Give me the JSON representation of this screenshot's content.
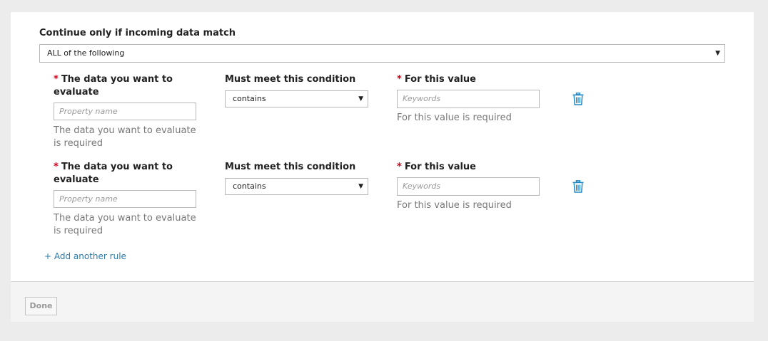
{
  "filter": {
    "match_label": "Continue only if incoming data match",
    "match_value": "ALL of the following"
  },
  "rules": [
    {
      "required_mark": "*",
      "data_label_line1": "The data you want to",
      "data_label_line2": "evaluate",
      "data_placeholder": "Property name",
      "data_hint_line1": "The data you want to evaluate",
      "data_hint_line2": "is required",
      "condition_label": "Must meet this condition",
      "condition_value": "contains",
      "value_label": "For this value",
      "value_placeholder": "Keywords",
      "value_hint": "For this value is required",
      "delete_icon": "trash-icon"
    },
    {
      "required_mark": "*",
      "data_label_line1": "The data you want to",
      "data_label_line2": "evaluate",
      "data_placeholder": "Property name",
      "data_hint_line1": "The data you want to evaluate",
      "data_hint_line2": "is required",
      "condition_label": "Must meet this condition",
      "condition_value": "contains",
      "value_label": "For this value",
      "value_placeholder": "Keywords",
      "value_hint": "For this value is required",
      "delete_icon": "trash-icon"
    }
  ],
  "actions": {
    "add_rule_label": "+ Add another rule",
    "done_label": "Done"
  },
  "colors": {
    "required": "#d0021b",
    "link": "#2a7ab0",
    "icon": "#1f88c4"
  }
}
